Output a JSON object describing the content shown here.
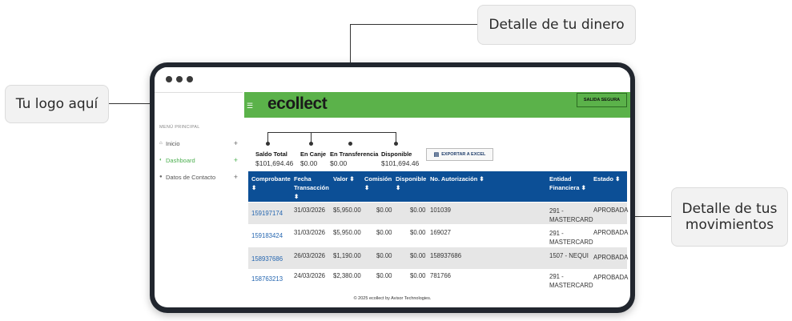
{
  "callouts": {
    "logo": "Tu logo aquí",
    "money": "Detalle de tu dinero",
    "movements": "Detalle de tus movimientos"
  },
  "app": {
    "brand": "ecollect",
    "exit_label": "SALIDA SEGURA",
    "menu_title": "MENÚ PRINCIPAL",
    "sidebar": [
      {
        "label": "Inicio",
        "icon": "home-icon"
      },
      {
        "label": "Dashboard",
        "icon": "dashboard-icon"
      },
      {
        "label": "Datos de Contacto",
        "icon": "user-icon"
      }
    ],
    "stats": [
      {
        "label": "Saldo Total",
        "value": "$101,694.46"
      },
      {
        "label": "En Canje",
        "value": "$0.00"
      },
      {
        "label": "En Transferencia",
        "value": "$0.00"
      },
      {
        "label": "Disponible",
        "value": "$101,694.46"
      }
    ],
    "export_label": "EXPORTAR A EXCEL",
    "table": {
      "headers": [
        "Comprobante ⬍",
        "Fecha Transacción ⬍",
        "Valor ⬍",
        "Comisión ⬍",
        "Disponible ⬍",
        "No. Autorización ⬍",
        "Entidad Financiera ⬍",
        "Estado ⬍"
      ],
      "rows": [
        [
          "159197174",
          "31/03/2026",
          "$5,950.00",
          "$0.00",
          "$0.00",
          "101039",
          "291 - MASTERCARD",
          "APROBADA"
        ],
        [
          "159183424",
          "31/03/2026",
          "$5,950.00",
          "$0.00",
          "$0.00",
          "169027",
          "291 - MASTERCARD",
          "APROBADA"
        ],
        [
          "158937686",
          "26/03/2026",
          "$1,190.00",
          "$0.00",
          "$0.00",
          "158937686",
          "1507 - NEQUI",
          "APROBADA"
        ],
        [
          "158763213",
          "24/03/2026",
          "$2,380.00",
          "$0.00",
          "$0.00",
          "781766",
          "291 - MASTERCARD",
          "APROBADA"
        ]
      ]
    },
    "footer": "© 2025 ecollect by Avisor Technologies."
  },
  "colors": {
    "header_green": "#5bb24a",
    "table_blue": "#0c4f96",
    "link_blue": "#2566b0"
  }
}
